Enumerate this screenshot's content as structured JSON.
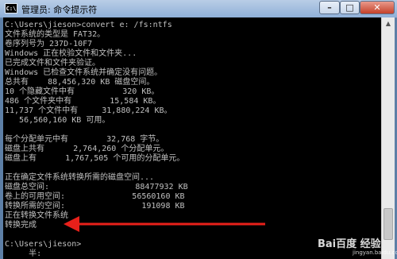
{
  "window": {
    "icon_text": "C:\\",
    "title": "管理员: 命令提示符",
    "controls": {
      "minimize": "–",
      "maximize": "□",
      "close": "✕"
    }
  },
  "console": {
    "lines": [
      "C:\\Users\\jieson>convert e: /fs:ntfs",
      "文件系统的类型是 FAT32。",
      "卷序列号为 237D-10F7",
      "Windows 正在校验文件和文件夹...",
      "已完成文件和文件夹验证。",
      "Windows 已检查文件系统并确定没有问题。",
      "总共有    88,456,320 KB 磁盘空间。",
      "10 个隐藏文件中有          320 KB。",
      "486 个文件夹中有        15,584 KB。",
      "11,737 个文件中有     31,880,224 KB。",
      "   56,560,160 KB 可用。",
      "",
      "每个分配单元中有        32,768 字节。",
      "磁盘上共有      2,764,260 个分配单元。",
      "磁盘上有      1,767,505 个可用的分配单元。",
      "",
      "正在确定文件系统转换所需的磁盘空间...",
      "磁盘总空间:                  88477932 KB",
      "卷上的可用空间:              56560160 KB",
      "转换所需的空间:                191098 KB",
      "正在转换文件系统",
      "转换完成",
      "",
      "C:\\Users\\jieson>",
      "     半:"
    ]
  },
  "annotation": {
    "arrow_color": "#e8201a"
  },
  "watermark": {
    "logo": "Bai百度 经验",
    "url": "jingyan.baidu.com"
  }
}
